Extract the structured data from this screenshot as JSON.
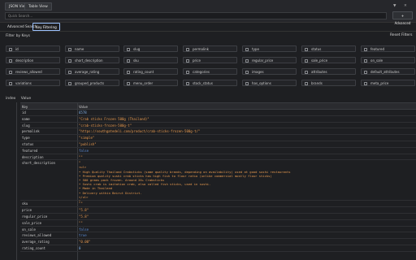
{
  "topbar": {
    "tabs": [
      "JSON View",
      "Table View"
    ],
    "search_placeholder": "Quick Search...",
    "advanced_label": "Advanced",
    "icons": [
      "chevron-down-icon",
      "close-icon"
    ]
  },
  "modes": [
    "Advanced Search",
    "Key Filtering"
  ],
  "active_mode": "Key Filtering",
  "filter": {
    "title": "Filter by Keys",
    "reset_label": "Reset Filters",
    "keys": [
      "id",
      "name",
      "slug",
      "permalink",
      "type",
      "status",
      "featured",
      "description",
      "short_description",
      "sku",
      "price",
      "regular_price",
      "sale_price",
      "on_sale",
      "reviews_allowed",
      "average_rating",
      "rating_count",
      "categories",
      "images",
      "attributes",
      "default_attributes",
      "variations",
      "grouped_products",
      "menu_order",
      "stock_status",
      "has_options",
      "brands",
      "meta_price"
    ]
  },
  "table": {
    "index_label": "index",
    "value_label": "Value",
    "col_key": "Key",
    "col_value": "Value",
    "rows": [
      {
        "key": "id",
        "value": "6578",
        "kind": "num"
      },
      {
        "key": "name",
        "value": "\"Crab sticks Frozen 500g (Thailand)\"",
        "kind": "str"
      },
      {
        "key": "slug",
        "value": "\"crab-sticks-frozen-500g-t\"",
        "kind": "str"
      },
      {
        "key": "permalink",
        "value": "\"https://southgatedeli.com/product/crab-sticks-frozen-500g-t/\"",
        "kind": "str"
      },
      {
        "key": "type",
        "value": "\"simple\"",
        "kind": "str"
      },
      {
        "key": "status",
        "value": "\"publish\"",
        "kind": "str"
      },
      {
        "key": "featured",
        "value": "false",
        "kind": "bool"
      },
      {
        "key": "description",
        "value": "\"\"",
        "kind": "str"
      },
      {
        "key": "short_description",
        "value": "\"",
        "kind": "str"
      },
      {
        "key": "sku",
        "value": "\"\"",
        "kind": "str"
      },
      {
        "key": "price",
        "value": "\"5.8\"",
        "kind": "str"
      },
      {
        "key": "regular_price",
        "value": "\"5.8\"",
        "kind": "str"
      },
      {
        "key": "sale_price",
        "value": "\"\"",
        "kind": "str"
      },
      {
        "key": "on_sale",
        "value": "false",
        "kind": "bool"
      },
      {
        "key": "reviews_allowed",
        "value": "true",
        "kind": "bool"
      },
      {
        "key": "average_rating",
        "value": "\"0.00\"",
        "kind": "str"
      },
      {
        "key": "rating_count",
        "value": "0",
        "kind": "num"
      }
    ],
    "short_description_lines": [
      "<ul>",
      "• High Quality Thailand Crabsticks (same quality brands, depending on availability) used at good sushi restaurants",
      "• Premium quality sushi crab sticks has high fish to flour ratio (unlike commercial mostly flour sticks)",
      "• 500 grams pack frozen. Around 20+ Crabsticks",
      "• Sushi crab is imitation crab, also called fish sticks, used in sushi.",
      "• Made in Thailand",
      "• Delivery within Beirut District.",
      "</ul>",
      "\""
    ]
  }
}
